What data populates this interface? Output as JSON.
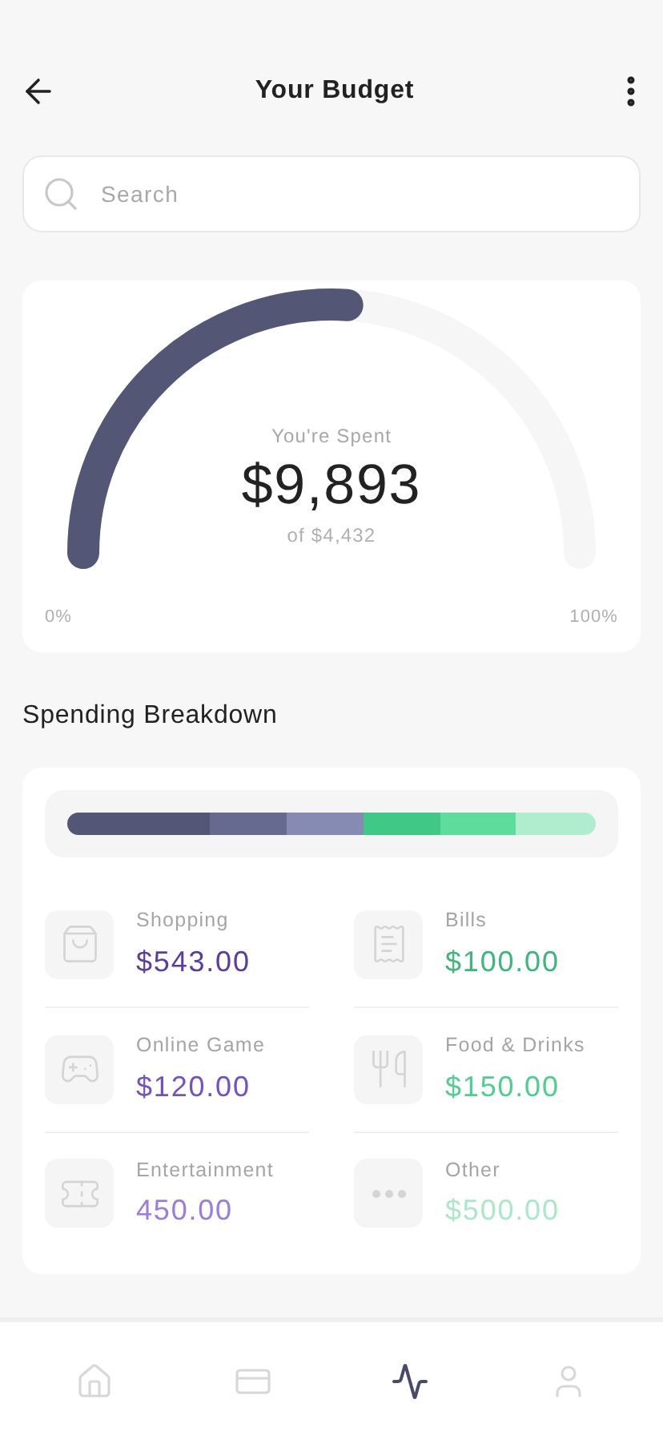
{
  "header": {
    "title": "Your Budget"
  },
  "search": {
    "placeholder": "Search"
  },
  "gauge": {
    "label": "You're Spent",
    "amount": "$9,893",
    "limit": "of $4,432",
    "min_label": "0%",
    "max_label": "100%"
  },
  "breakdown": {
    "title": "Spending Breakdown",
    "segments": [
      {
        "color": "#535674"
      },
      {
        "color": "#676a8f"
      },
      {
        "color": "#868bb3"
      },
      {
        "color": "#40c986"
      },
      {
        "color": "#5ddc9c"
      },
      {
        "color": "#b0ecce"
      }
    ],
    "categories": [
      {
        "kind": "shopping",
        "label": "Shopping",
        "amount": "$543.00",
        "color": "#5b3e9c"
      },
      {
        "kind": "bills",
        "label": "Bills",
        "amount": "$100.00",
        "color": "#3eb67c"
      },
      {
        "kind": "game",
        "label": "Online Game",
        "amount": "$120.00",
        "color": "#7352c4"
      },
      {
        "kind": "food",
        "label": "Food & Drinks",
        "amount": "$150.00",
        "color": "#4fcf8f"
      },
      {
        "kind": "entertainment",
        "label": "Entertainment",
        "amount": "450.00",
        "color": "#9a7ddc"
      },
      {
        "kind": "other",
        "label": "Other",
        "amount": "$500.00",
        "color": "#abe8c9"
      }
    ]
  },
  "nav": [
    {
      "kind": "home",
      "selected": false
    },
    {
      "kind": "card",
      "selected": false
    },
    {
      "kind": "activity",
      "selected": true
    },
    {
      "kind": "profile",
      "selected": false
    }
  ]
}
